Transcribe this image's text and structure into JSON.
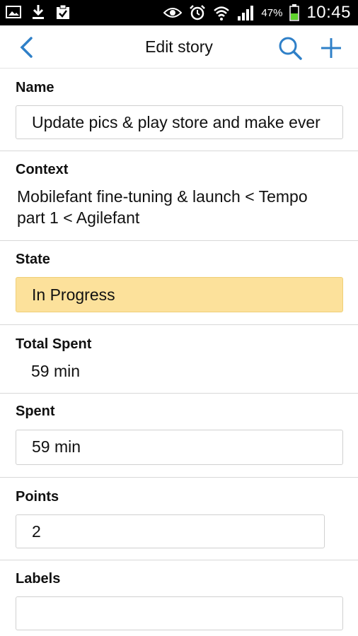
{
  "status_bar": {
    "battery_percent": "47%",
    "time": "10:45",
    "icons": [
      "gallery-icon",
      "download-icon",
      "clipboard-check-icon",
      "eye-icon",
      "alarm-icon",
      "wifi-icon",
      "signal-icon",
      "battery-icon"
    ]
  },
  "header": {
    "title": "Edit story",
    "back_icon": "chevron-left-icon",
    "search_icon": "search-icon",
    "add_icon": "plus-icon",
    "accent_color": "#2f80c8"
  },
  "form": {
    "name": {
      "label": "Name",
      "value": "Update pics & play store and make ever"
    },
    "context": {
      "label": "Context",
      "line1": "Mobilefant fine-tuning & launch < Tempo",
      "line2": "part 1 < Agilefant"
    },
    "state": {
      "label": "State",
      "value": "In Progress",
      "color": "#fce19b"
    },
    "total_spent": {
      "label": "Total Spent",
      "value": "59 min"
    },
    "spent": {
      "label": "Spent",
      "value": "59 min"
    },
    "points": {
      "label": "Points",
      "value": "2"
    },
    "labels": {
      "label": "Labels",
      "value": ""
    }
  }
}
